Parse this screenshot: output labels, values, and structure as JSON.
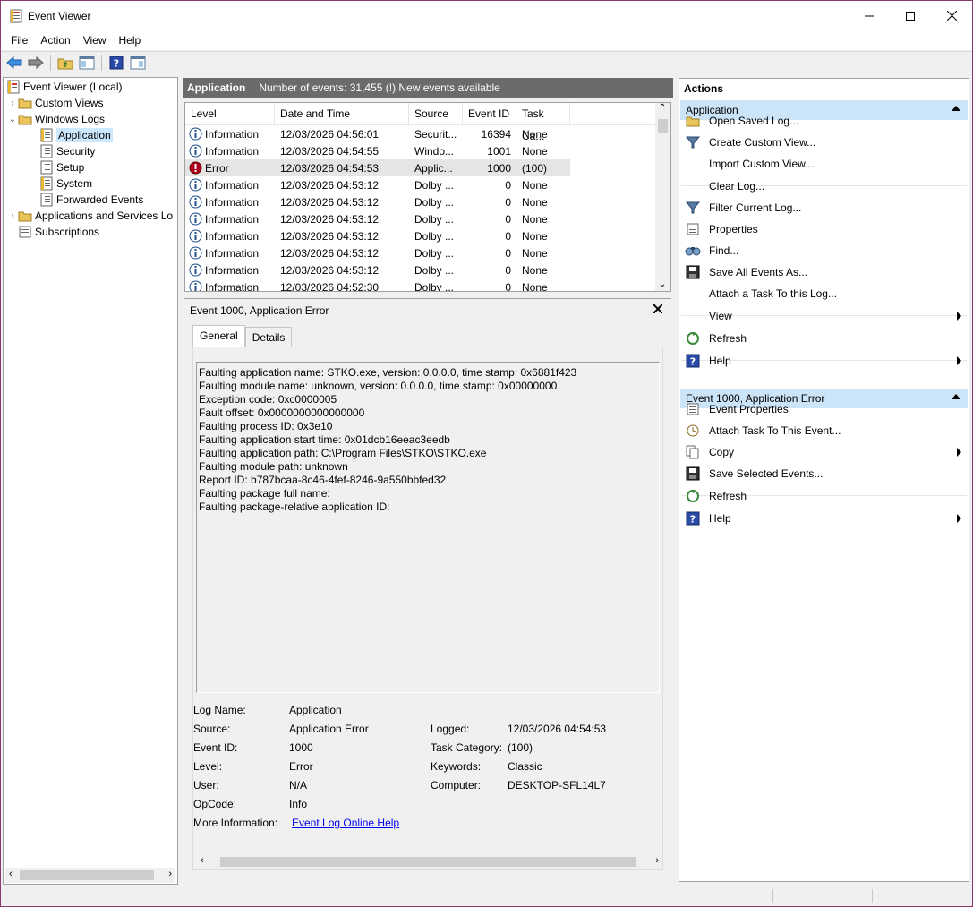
{
  "window": {
    "title": "Event Viewer"
  },
  "menu": [
    "File",
    "Action",
    "View",
    "Help"
  ],
  "tree": {
    "root": "Event Viewer (Local)",
    "custom_views": "Custom Views",
    "windows_logs": "Windows Logs",
    "application": "Application",
    "security": "Security",
    "setup": "Setup",
    "system": "System",
    "forwarded": "Forwarded Events",
    "apps_services": "Applications and Services Lo",
    "subscriptions": "Subscriptions"
  },
  "log_header": {
    "name": "Application",
    "summary": "Number of events: 31,455 (!) New events available"
  },
  "grid": {
    "columns": [
      "Level",
      "Date and Time",
      "Source",
      "Event ID",
      "Task Ca..."
    ],
    "rows": [
      {
        "level": "Information",
        "date": "12/03/2026 04:56:01",
        "source": "Securit...",
        "id": "16394",
        "task": "None"
      },
      {
        "level": "Information",
        "date": "12/03/2026 04:54:55",
        "source": "Windo...",
        "id": "1001",
        "task": "None"
      },
      {
        "level": "Error",
        "date": "12/03/2026 04:54:53",
        "source": "Applic...",
        "id": "1000",
        "task": "(100)"
      },
      {
        "level": "Information",
        "date": "12/03/2026 04:53:12",
        "source": "Dolby ...",
        "id": "0",
        "task": "None"
      },
      {
        "level": "Information",
        "date": "12/03/2026 04:53:12",
        "source": "Dolby ...",
        "id": "0",
        "task": "None"
      },
      {
        "level": "Information",
        "date": "12/03/2026 04:53:12",
        "source": "Dolby ...",
        "id": "0",
        "task": "None"
      },
      {
        "level": "Information",
        "date": "12/03/2026 04:53:12",
        "source": "Dolby ...",
        "id": "0",
        "task": "None"
      },
      {
        "level": "Information",
        "date": "12/03/2026 04:53:12",
        "source": "Dolby ...",
        "id": "0",
        "task": "None"
      },
      {
        "level": "Information",
        "date": "12/03/2026 04:53:12",
        "source": "Dolby ...",
        "id": "0",
        "task": "None"
      },
      {
        "level": "Information",
        "date": "12/03/2026 04:52:30",
        "source": "Dolby ...",
        "id": "0",
        "task": "None"
      }
    ]
  },
  "detail": {
    "title": "Event 1000, Application Error",
    "tabs": [
      "General",
      "Details"
    ],
    "message": [
      "Faulting application name: STKO.exe, version: 0.0.0.0, time stamp: 0x6881f423",
      "Faulting module name: unknown, version: 0.0.0.0, time stamp: 0x00000000",
      "Exception code: 0xc0000005",
      "Fault offset: 0x0000000000000000",
      "Faulting process ID: 0x3e10",
      "Faulting application start time: 0x01dcb16eeac3eedb",
      "Faulting application path: C:\\Program Files\\STKO\\STKO.exe",
      "Faulting module path: unknown",
      "Report ID: b787bcaa-8c46-4fef-8246-9a550bbfed32",
      "Faulting package full name: ",
      "Faulting package-relative application ID: "
    ],
    "props": {
      "log_name_label": "Log Name:",
      "log_name": "Application",
      "source_label": "Source:",
      "source": "Application Error",
      "logged_label": "Logged:",
      "logged": "12/03/2026 04:54:53",
      "event_id_label": "Event ID:",
      "event_id": "1000",
      "task_cat_label": "Task Category:",
      "task_cat": "(100)",
      "level_label": "Level:",
      "level": "Error",
      "keywords_label": "Keywords:",
      "keywords": "Classic",
      "user_label": "User:",
      "user": "N/A",
      "computer_label": "Computer:",
      "computer": "DESKTOP-SFL14L7",
      "opcode_label": "OpCode:",
      "opcode": "Info",
      "more_info_label": "More Information:",
      "more_info_link": "Event Log Online Help"
    }
  },
  "actions": {
    "title": "Actions",
    "section1": "Application",
    "items1": [
      "Open Saved Log...",
      "Create Custom View...",
      "Import Custom View...",
      "Clear Log...",
      "Filter Current Log...",
      "Properties",
      "Find...",
      "Save All Events As...",
      "Attach a Task To this Log...",
      "View",
      "Refresh",
      "Help"
    ],
    "section2": "Event 1000, Application Error",
    "items2": [
      "Event Properties",
      "Attach Task To This Event...",
      "Copy",
      "Save Selected Events...",
      "Refresh",
      "Help"
    ]
  },
  "colors": {
    "header_bg": "#6b6b6b",
    "section_bg": "#cce4f7",
    "selection": "#cce8ff",
    "error_red": "#b00020",
    "info_blue": "#1f4e8c",
    "link": "#0000ee"
  }
}
